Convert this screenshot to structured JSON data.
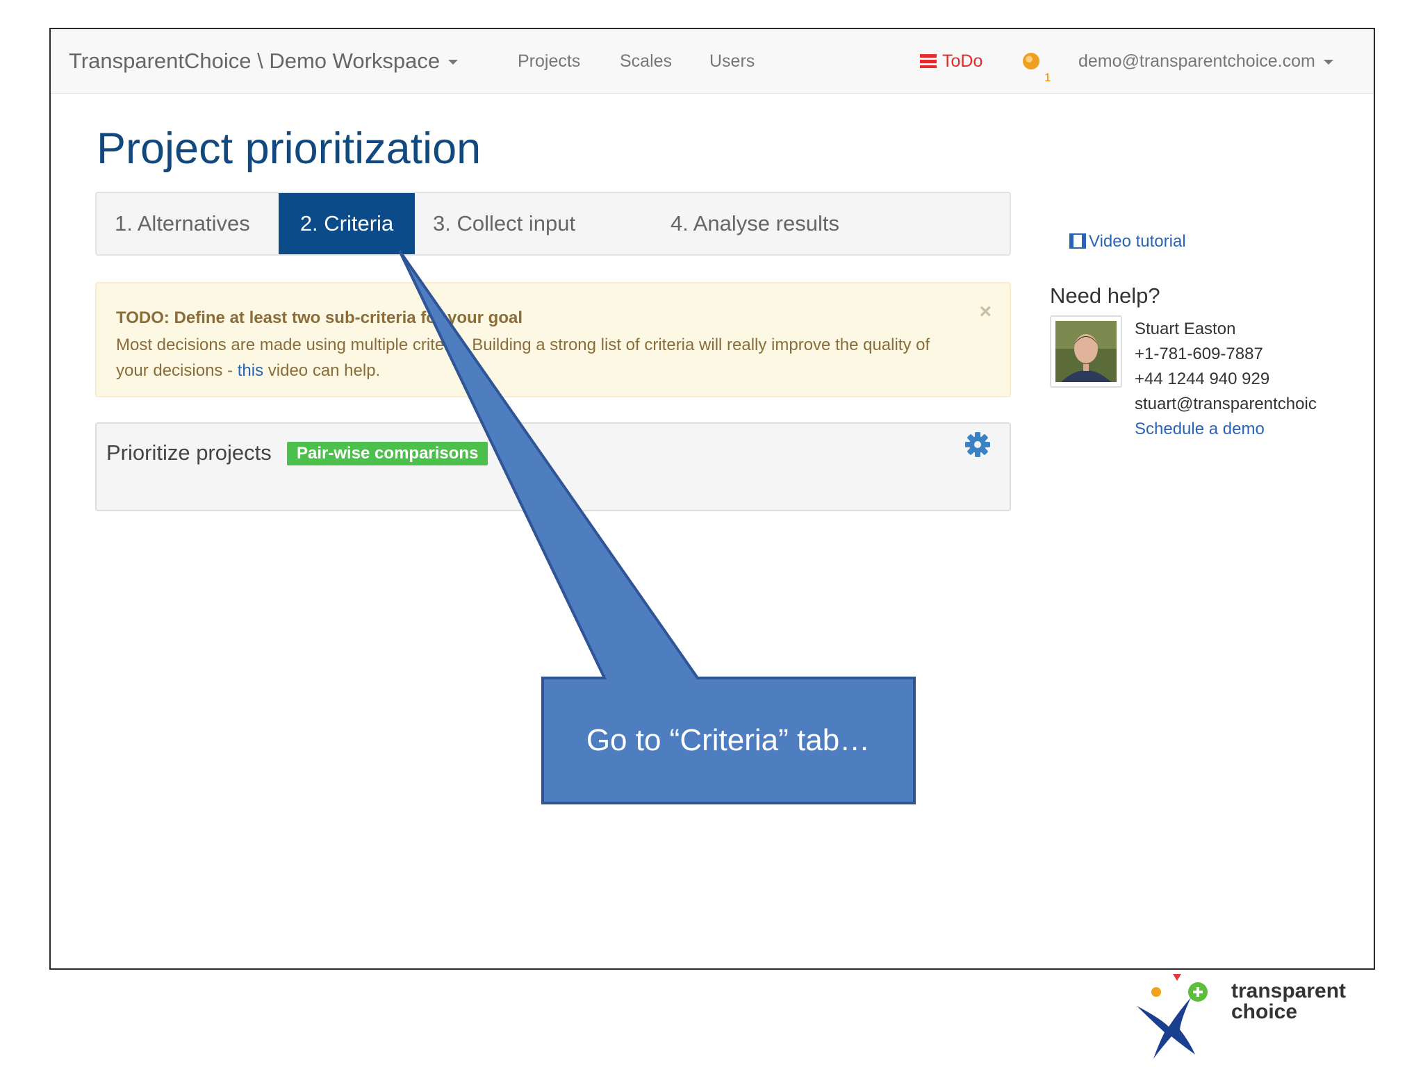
{
  "navbar": {
    "brand": "TransparentChoice \\ Demo Workspace",
    "links": [
      "Projects",
      "Scales",
      "Users"
    ],
    "todo_label": "ToDo",
    "notification_count": "1",
    "user_email": "demo@transparentchoice.com"
  },
  "page": {
    "title": "Project prioritization",
    "tabs": [
      "1. Alternatives",
      "2. Criteria",
      "3. Collect input",
      "4. Analyse results"
    ],
    "active_tab": "2. Criteria"
  },
  "alert": {
    "title": "TODO: Define at least two sub-criteria for your goal",
    "body_before": "Most decisions are made using multiple criteria. Building a strong list of criteria will really improve the quality of your decisions - ",
    "link_text": "this",
    "body_after": " video can help.",
    "close": "×"
  },
  "panel": {
    "title": "Prioritize projects",
    "badge": "Pair-wise comparisons",
    "settings_icon": "gear-icon"
  },
  "sidebar": {
    "video_link": "Video tutorial",
    "help_heading": "Need help?",
    "contact_name": "Stuart Easton",
    "phone_us": "+1-781-609-7887",
    "phone_uk": "+44 1244 940 929",
    "email": "stuart@transparentchoic",
    "schedule_link": "Schedule a demo"
  },
  "callout": {
    "text": "Go to “Criteria” tab…"
  },
  "logo": {
    "line1": "transparent",
    "line2": "choice"
  },
  "colors": {
    "brand_blue": "#11497f",
    "active_tab": "#0b4b8a",
    "link": "#2a64b6",
    "badge_green": "#4dbf4d",
    "todo_red": "#e42a2a",
    "callout_fill": "#4f7ec0",
    "callout_stroke": "#2f5597"
  }
}
